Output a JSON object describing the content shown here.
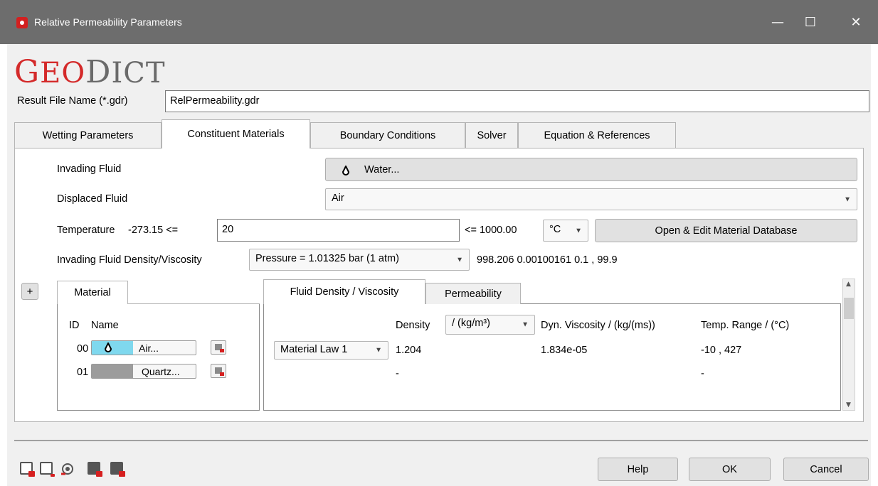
{
  "window": {
    "title": "Relative Permeability Parameters",
    "minimize_label": "—",
    "maximize_label": "☐",
    "close_label": "✕"
  },
  "logo": {
    "g": "G",
    "eo": "EO",
    "d": "D",
    "ict": "ICT"
  },
  "result_file": {
    "label": "Result File Name (*.gdr)",
    "value": "RelPermeability.gdr"
  },
  "tabs": [
    {
      "label": "Wetting Parameters"
    },
    {
      "label": "Constituent Materials"
    },
    {
      "label": "Boundary Conditions"
    },
    {
      "label": "Solver"
    },
    {
      "label": "Equation & References"
    }
  ],
  "constituent": {
    "invading_label": "Invading Fluid",
    "invading_value": "Water...",
    "displaced_label": "Displaced Fluid",
    "displaced_value": "Air",
    "temperature_label": "Temperature",
    "temp_min": "-273.15 <=",
    "temperature_value": "20",
    "temp_max": "<= 1000.00",
    "temp_unit": "°C",
    "open_db_label": "Open & Edit Material Database",
    "density_label": "Invading Fluid Density/Viscosity",
    "pressure_value": "Pressure = 1.01325 bar (1 atm)",
    "density_readout": "998.206  0.00100161  0.1 , 99.9"
  },
  "materials": {
    "plus_label": "+",
    "tab_label": "Material",
    "id_header": "ID",
    "name_header": "Name",
    "rows": [
      {
        "id": "00",
        "name": "Air...",
        "swatch_color": "#7fd8ee",
        "icon": "drop-icon"
      },
      {
        "id": "01",
        "name": "Quartz...",
        "swatch_color": "#9c9c9c",
        "icon": ""
      }
    ]
  },
  "properties": {
    "tab_fluid": "Fluid Density / Viscosity",
    "tab_perm": "Permeability",
    "density_header": "Density",
    "density_unit": "/ (kg/m³)",
    "viscosity_header": "Dyn. Viscosity / (kg/(ms))",
    "temp_range_header": "Temp. Range / (°C)",
    "rows": [
      {
        "law": "Material Law 1",
        "density": "1.204",
        "viscosity": "1.834e-05",
        "temp_range": "-10 , 427"
      },
      {
        "law": "",
        "density": "-",
        "viscosity": "",
        "temp_range": "-"
      }
    ]
  },
  "footer": {
    "help_label": "Help",
    "ok_label": "OK",
    "cancel_label": "Cancel"
  }
}
